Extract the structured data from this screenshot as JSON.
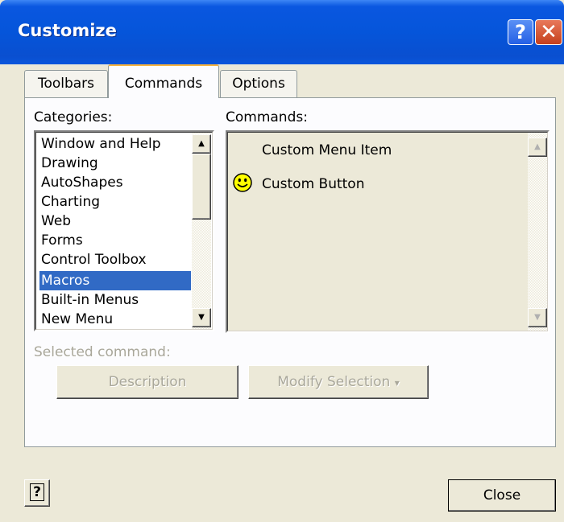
{
  "window": {
    "title": "Customize",
    "help_glyph": "?",
    "close_glyph": "✕"
  },
  "tabs": [
    {
      "label": "Toolbars"
    },
    {
      "label": "Commands"
    },
    {
      "label": "Options"
    }
  ],
  "categories": {
    "label": "Categories:",
    "items": [
      "Window and Help",
      "Drawing",
      "AutoShapes",
      "Charting",
      "Web",
      "Forms",
      "Control Toolbox",
      "Macros",
      "Built-in Menus",
      "New Menu"
    ],
    "selected": "Macros"
  },
  "commands": {
    "label": "Commands:",
    "items": [
      {
        "label": "Custom Menu Item",
        "icon": "none"
      },
      {
        "label": "Custom Button",
        "icon": "smiley-icon"
      }
    ]
  },
  "selected_command": {
    "label": "Selected command:",
    "description_button": "Description",
    "modify_button": "Modify Selection",
    "modify_arrow": "▾"
  },
  "footer": {
    "help_glyph": "?",
    "close_button": "Close"
  },
  "colors": {
    "selection": "#316ac5",
    "titlebar": "#0a56dc",
    "dialog_bg": "#ece9d8"
  }
}
